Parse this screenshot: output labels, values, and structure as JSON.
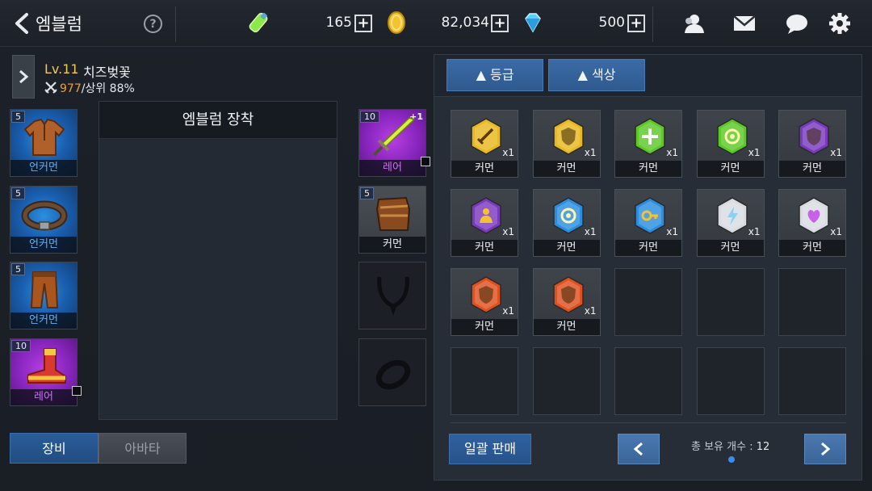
{
  "header": {
    "title": "엠블럼",
    "help_label": "?",
    "resources": [
      {
        "icon": "stamina-potion-icon",
        "value": "165"
      },
      {
        "icon": "gold-coin-icon",
        "value": "82,034"
      },
      {
        "icon": "diamond-icon",
        "value": "500"
      }
    ],
    "plus_label": "+"
  },
  "character": {
    "level": "Lv.11",
    "name": "치즈벚꽃",
    "power": "977",
    "rank": "/상위 88%"
  },
  "left_slots": [
    {
      "level": "5",
      "grade": "언커먼",
      "item": "leather-shirt-icon"
    },
    {
      "level": "5",
      "grade": "언커먼",
      "item": "belt-icon"
    },
    {
      "level": "5",
      "grade": "언커먼",
      "item": "leather-pants-icon"
    },
    {
      "level": "10",
      "grade": "레어",
      "item": "boots-icon"
    }
  ],
  "right_slots": [
    {
      "level": "10",
      "enhance": "+1",
      "grade": "레어",
      "item": "sword-icon"
    },
    {
      "level": "5",
      "grade": "커먼",
      "item": "gloves-icon"
    },
    {
      "item": "necklace-empty-icon"
    },
    {
      "item": "ring-empty-icon"
    }
  ],
  "emblem_panel": {
    "title": "엠블럼 장착"
  },
  "tabs": {
    "equip": "장비",
    "avatar": "아바타"
  },
  "inventory": {
    "sort_grade": "▲ 등급",
    "sort_color": "▲ 색상",
    "items": [
      {
        "gem": "gold-sword-emblem-icon",
        "qty": "x1",
        "grade": "커먼",
        "color": "#e8b820"
      },
      {
        "gem": "gold-shield-emblem-icon",
        "qty": "x1",
        "grade": "커먼",
        "color": "#e8b820"
      },
      {
        "gem": "green-cross-emblem-icon",
        "qty": "x1",
        "grade": "커먼",
        "color": "#5cc828"
      },
      {
        "gem": "green-target-emblem-icon",
        "qty": "x1",
        "grade": "커먼",
        "color": "#5cc828"
      },
      {
        "gem": "purple-shield-emblem-icon",
        "qty": "x1",
        "grade": "커먼",
        "color": "#7a3ac0"
      },
      {
        "gem": "purple-person-emblem-icon",
        "qty": "x1",
        "grade": "커먼",
        "color": "#7a3ac0"
      },
      {
        "gem": "blue-target-emblem-icon",
        "qty": "x1",
        "grade": "커먼",
        "color": "#2a8ee0"
      },
      {
        "gem": "blue-key-emblem-icon",
        "qty": "x1",
        "grade": "커먼",
        "color": "#2a8ee0"
      },
      {
        "gem": "white-bolt-emblem-icon",
        "qty": "x1",
        "grade": "커먼",
        "color": "#d8dce2"
      },
      {
        "gem": "white-heart-emblem-icon",
        "qty": "x1",
        "grade": "커먼",
        "color": "#d8dce2"
      },
      {
        "gem": "red-shield-emblem-icon",
        "qty": "x1",
        "grade": "커먼",
        "color": "#e0501e"
      },
      {
        "gem": "red-shield-emblem-icon",
        "qty": "x1",
        "grade": "커먼",
        "color": "#e0501e"
      }
    ],
    "bulk_sell": "일괄 판매",
    "count_label": "총 보유 개수 : ",
    "count": "12"
  }
}
